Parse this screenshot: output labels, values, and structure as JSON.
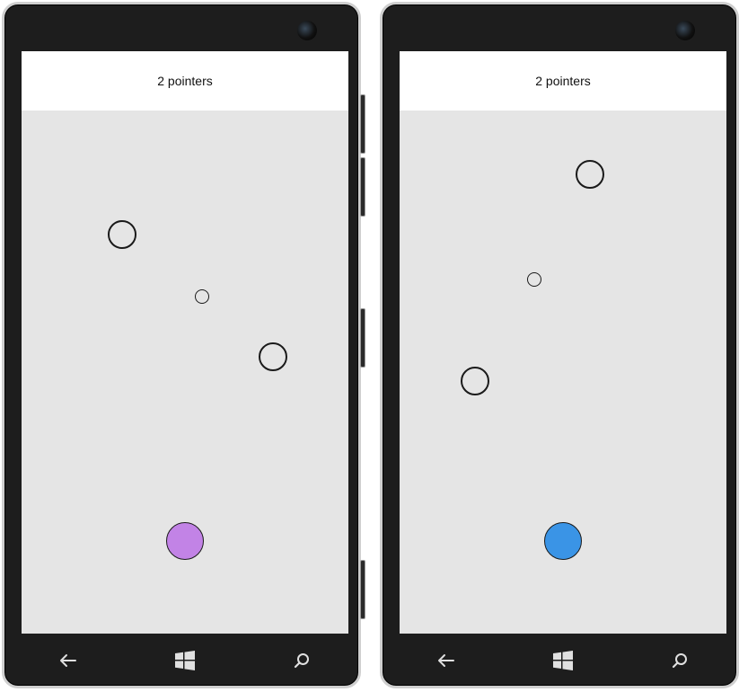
{
  "phones": [
    {
      "status_text": "2 pointers",
      "dot_color": "#c283e6",
      "nav": {
        "back_icon": "back-arrow-icon",
        "start_icon": "windows-logo-icon",
        "search_icon": "search-icon"
      }
    },
    {
      "status_text": "2 pointers",
      "dot_color": "#3a94e6",
      "nav": {
        "back_icon": "back-arrow-icon",
        "start_icon": "windows-logo-icon",
        "search_icon": "search-icon"
      }
    }
  ],
  "colors": {
    "screen_bg": "#e5e5e5",
    "header_bg": "#ffffff",
    "bezel": "#1d1d1d"
  }
}
